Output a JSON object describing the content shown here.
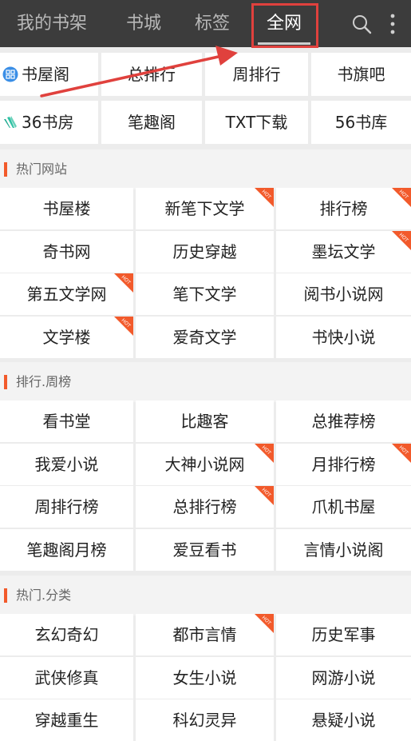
{
  "topbar": {
    "tabs": [
      {
        "label": "我的书架",
        "active": false
      },
      {
        "label": "书城",
        "active": false
      },
      {
        "label": "标签",
        "active": false
      },
      {
        "label": "全网",
        "active": true
      }
    ]
  },
  "quick_sites": {
    "row1": [
      "书屋阁",
      "总排行",
      "周排行",
      "书旗吧"
    ],
    "row2": [
      "36书房",
      "笔趣阁",
      "TXT下载",
      "56书库"
    ]
  },
  "sections": [
    {
      "title": "热门网站",
      "items": [
        {
          "label": "书屋楼",
          "hot": false
        },
        {
          "label": "新笔下文学",
          "hot": true
        },
        {
          "label": "排行榜",
          "hot": true
        },
        {
          "label": "奇书网",
          "hot": false
        },
        {
          "label": "历史穿越",
          "hot": false
        },
        {
          "label": "墨坛文学",
          "hot": true
        },
        {
          "label": "第五文学网",
          "hot": true
        },
        {
          "label": "笔下文学",
          "hot": false
        },
        {
          "label": "阅书小说网",
          "hot": false
        },
        {
          "label": "文学楼",
          "hot": true
        },
        {
          "label": "爱奇文学",
          "hot": false
        },
        {
          "label": "书快小说",
          "hot": false
        }
      ]
    },
    {
      "title": "排行.周榜",
      "items": [
        {
          "label": "看书堂",
          "hot": false
        },
        {
          "label": "比趣客",
          "hot": false
        },
        {
          "label": "总推荐榜",
          "hot": false
        },
        {
          "label": "我爱小说",
          "hot": false
        },
        {
          "label": "大神小说网",
          "hot": true
        },
        {
          "label": "月排行榜",
          "hot": true
        },
        {
          "label": "周排行榜",
          "hot": false
        },
        {
          "label": "总排行榜",
          "hot": true
        },
        {
          "label": "爪机书屋",
          "hot": false
        },
        {
          "label": "笔趣阁月榜",
          "hot": false
        },
        {
          "label": "爱豆看书",
          "hot": false
        },
        {
          "label": "言情小说阁",
          "hot": false
        }
      ]
    },
    {
      "title": "热门.分类",
      "items": [
        {
          "label": "玄幻奇幻",
          "hot": false
        },
        {
          "label": "都市言情",
          "hot": true
        },
        {
          "label": "历史军事",
          "hot": false
        },
        {
          "label": "武侠修真",
          "hot": false
        },
        {
          "label": "女生小说",
          "hot": false
        },
        {
          "label": "网游小说",
          "hot": false
        },
        {
          "label": "穿越重生",
          "hot": false
        },
        {
          "label": "科幻灵异",
          "hot": false
        },
        {
          "label": "悬疑小说",
          "hot": false
        }
      ]
    }
  ],
  "hot_badge": "HOT",
  "colors": {
    "topbar": "#3c3c3c",
    "accent": "#f25a2b",
    "highlight": "#e0413d"
  }
}
